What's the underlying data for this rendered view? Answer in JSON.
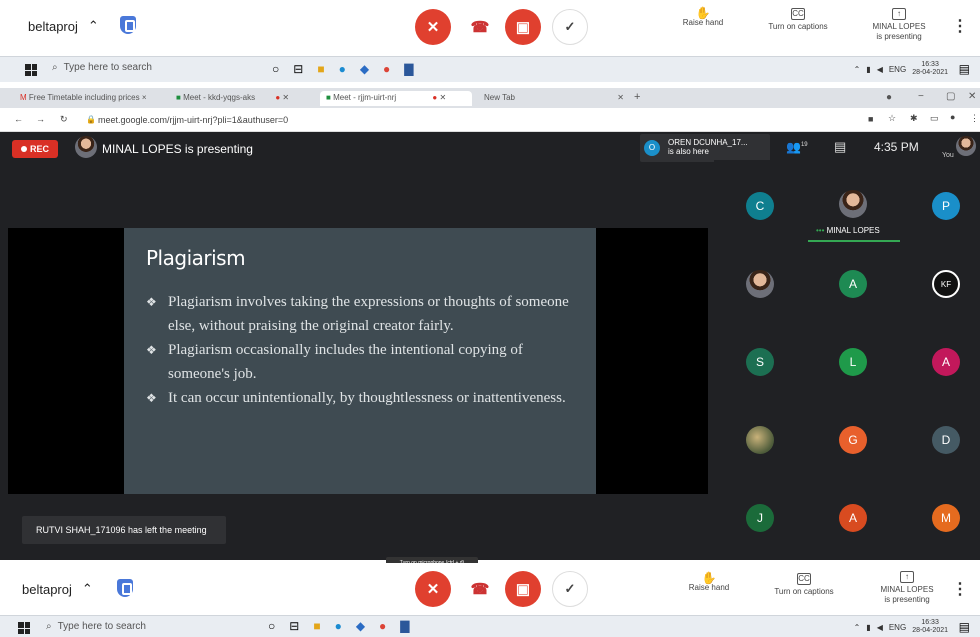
{
  "top_controls": {
    "project": "beltaproj",
    "raise_hand": "Raise hand",
    "captions": "Turn on captions",
    "presenter_line1": "MINAL LOPES",
    "presenter_line2": "is presenting"
  },
  "taskbar": {
    "search_placeholder": "Type here to search",
    "lang": "ENG",
    "time": "16:33",
    "date": "28-04-2021"
  },
  "browser": {
    "tabs": [
      "Free Timetable including prices ×",
      "Meet - kkd-yqgs-aks",
      "Meet - rjjm-uirt-nrj",
      "New Tab"
    ],
    "url": "meet.google.com/rjjm-uirt-nrj?pli=1&authuser=0"
  },
  "meet": {
    "rec_label": "REC",
    "presenting_text": "MINAL LOPES is presenting",
    "also_here_name": "OREN DCUNHA_17...",
    "also_here_text": "is also here",
    "people_count": "19",
    "clock": "4:35 PM",
    "you_label": "You",
    "participant_name": "MINAL LOPES",
    "tiles": [
      {
        "letter": "C",
        "color": "#0f7f8f"
      },
      {
        "letter": "P",
        "color": "#1a8fc9"
      },
      {
        "letter": "A",
        "color": "#1e8a53"
      },
      {
        "letter": "S",
        "color": "#1c6f52"
      },
      {
        "letter": "L",
        "color": "#1f9a4a"
      },
      {
        "letter": "A",
        "color": "#c2185b"
      },
      {
        "letter": "G",
        "color": "#e8602c"
      },
      {
        "letter": "D",
        "color": "#455a64"
      },
      {
        "letter": "J",
        "color": "#1b6b3a"
      },
      {
        "letter": "A",
        "color": "#d84b20"
      },
      {
        "letter": "M",
        "color": "#e56b1f"
      }
    ],
    "slide": {
      "title": "Plagiarism",
      "bullets": [
        "Plagiarism involves taking the expressions or thoughts of someone else, without praising the original creator fairly.",
        "Plagiarism occasionally includes the intentional copying of someone's job.",
        "It can occur unintentionally, by thoughtlessness or inattentiveness."
      ]
    },
    "toast": "RUTVI SHAH_171096 has left the meeting",
    "tooltip": "Turn on microphone (ctrl + d)"
  },
  "colors": {
    "red": "#e0402f",
    "meet_bg": "#202124",
    "slide_bg": "#3f4b52"
  }
}
